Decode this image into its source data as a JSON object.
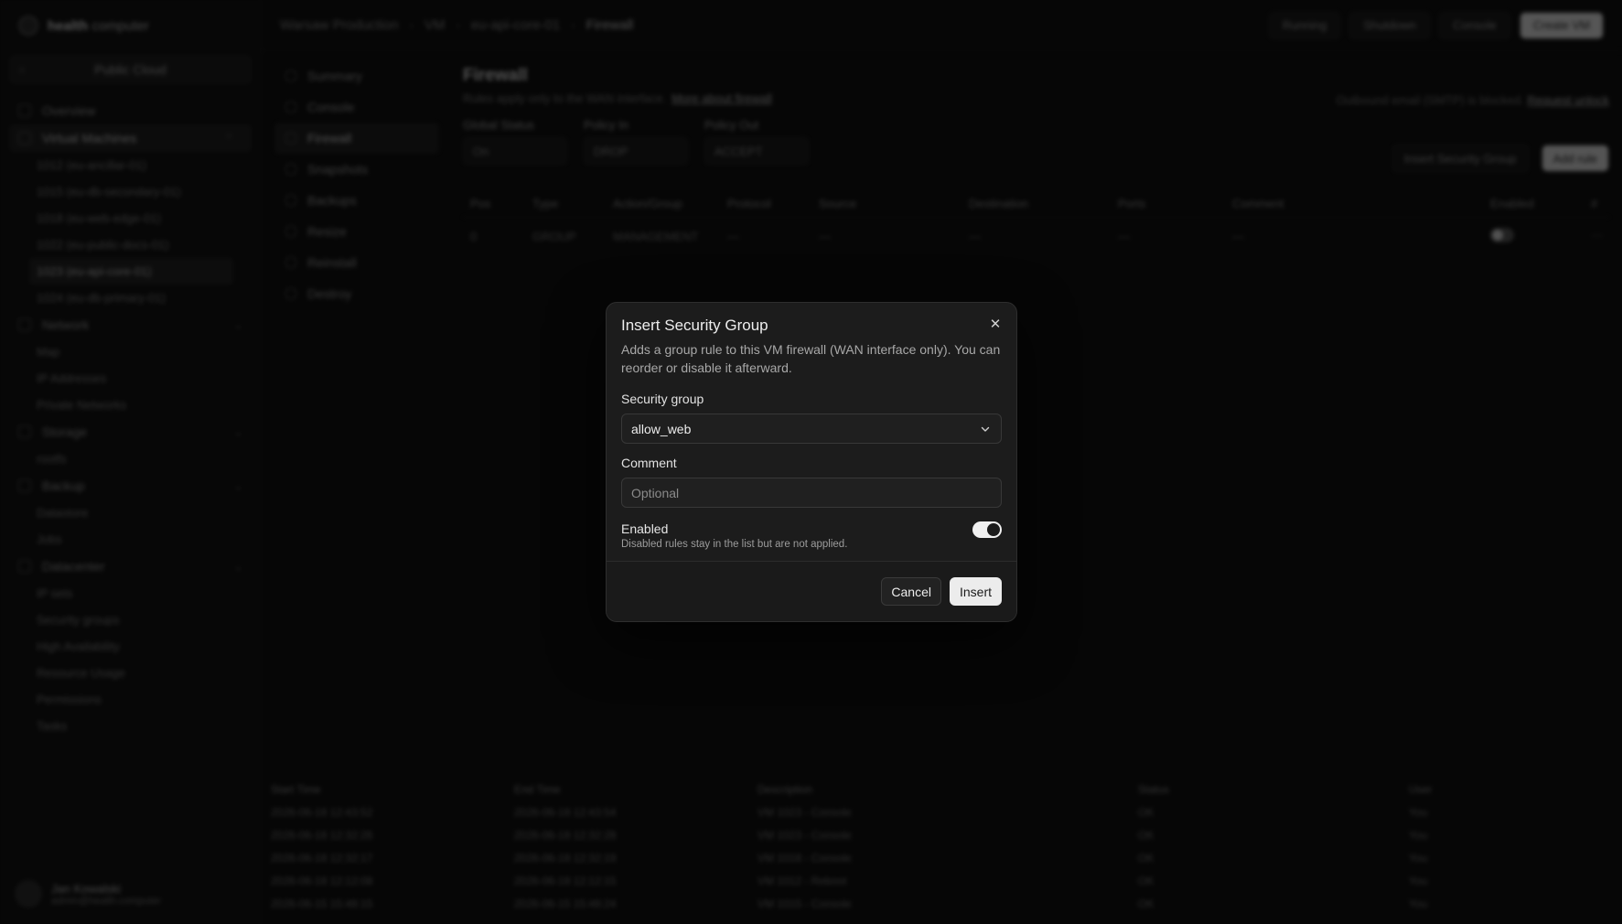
{
  "brand": {
    "name_bold": "health",
    "name_rest": "computer"
  },
  "sidebar": {
    "project_switch": "Public Cloud",
    "items": [
      {
        "label": "Overview"
      },
      {
        "label": "Virtual Machines"
      },
      {
        "label": "Network"
      },
      {
        "label": "Storage"
      },
      {
        "label": "Backup"
      },
      {
        "label": "Datacenter"
      }
    ],
    "vms": [
      "1012 (eu-ancillar-01)",
      "1015 (eu-db-secondary-01)",
      "1018 (eu-web-edge-01)",
      "1022 (eu-public-docs-01)",
      "1023 (eu-api-core-01)",
      "1024 (eu-db-primary-01)"
    ],
    "network_sub": [
      "Map",
      "IP Addresses",
      "Private Networks"
    ],
    "storage_sub": [
      "rootfs"
    ],
    "backup_sub": [
      "Datastore",
      "Jobs"
    ],
    "datacenter_sub": [
      "IP sets",
      "Security groups",
      "High Availability",
      "Resource Usage",
      "Permissions",
      "Tasks"
    ],
    "user": {
      "name": "Jan Kowalski",
      "email": "admin@health.computer"
    }
  },
  "topbar": {
    "crumbs": [
      "Warsaw Production",
      "VM",
      "eu-api-core-01",
      "Firewall"
    ],
    "status": "Running",
    "shutdown": "Shutdown",
    "console": "Console",
    "create": "Create VM"
  },
  "vm_nav": [
    "Summary",
    "Console",
    "Firewall",
    "Snapshots",
    "Backups",
    "Resize",
    "Reinstall",
    "Destroy"
  ],
  "firewall": {
    "title": "Firewall",
    "subtitle": "Rules apply only to the WAN interface.",
    "learn_more": "More about firewall",
    "outbound_note": "Outbound email (SMTP) is blocked.",
    "request_unlock": "Request unlock",
    "filters": [
      {
        "label": "Global Status",
        "value": "On"
      },
      {
        "label": "Policy In",
        "value": "DROP"
      },
      {
        "label": "Policy Out",
        "value": "ACCEPT"
      }
    ],
    "insert_sg_button": "Insert Security Group",
    "add_rule_button": "Add rule",
    "columns": [
      "Pos",
      "Type",
      "Action/Group",
      "Protocol",
      "Source",
      "Destination",
      "Ports",
      "Comment",
      "Enabled",
      "#"
    ],
    "rows": [
      {
        "pos": "0",
        "type": "GROUP",
        "action": "MANAGEMENT",
        "protocol": "—",
        "source": "—",
        "destination": "—",
        "ports": "—",
        "comment": "—",
        "more": "⋯"
      }
    ]
  },
  "tasks": {
    "columns": [
      "Start Time",
      "End Time",
      "Description",
      "Status",
      "User"
    ],
    "rows": [
      [
        "2026-06-18 12:43:52",
        "2026-06-18 12:43:54",
        "VM 1023 - Console",
        "OK",
        "You"
      ],
      [
        "2026-06-18 12:32:26",
        "2026-06-18 12:32:28",
        "VM 1023 - Console",
        "OK",
        "You"
      ],
      [
        "2026-06-18 12:32:17",
        "2026-06-18 12:32:19",
        "VM 1018 - Console",
        "OK",
        "You"
      ],
      [
        "2026-06-18 12:12:08",
        "2026-06-18 12:12:15",
        "VM 1012 - Reboot",
        "OK",
        "You"
      ],
      [
        "2026-06-15 15:48:15",
        "2026-06-15 15:48:24",
        "VM 1015 - Console",
        "OK",
        "You"
      ]
    ]
  },
  "modal": {
    "title": "Insert Security Group",
    "description": "Adds a group rule to this VM firewall (WAN interface only). You can reorder or disable it afterward.",
    "security_group_label": "Security group",
    "security_group_value": "allow_web",
    "comment_label": "Comment",
    "comment_placeholder": "Optional",
    "comment_value": "",
    "enabled_label": "Enabled",
    "enabled_hint": "Disabled rules stay in the list but are not applied.",
    "enabled": true,
    "cancel_label": "Cancel",
    "insert_label": "Insert"
  },
  "colors": {
    "overlay": "#000000",
    "modal_bg": "#1c1c1c",
    "primary_btn": "#ececec",
    "toggle_on": "#f1f1f1"
  }
}
